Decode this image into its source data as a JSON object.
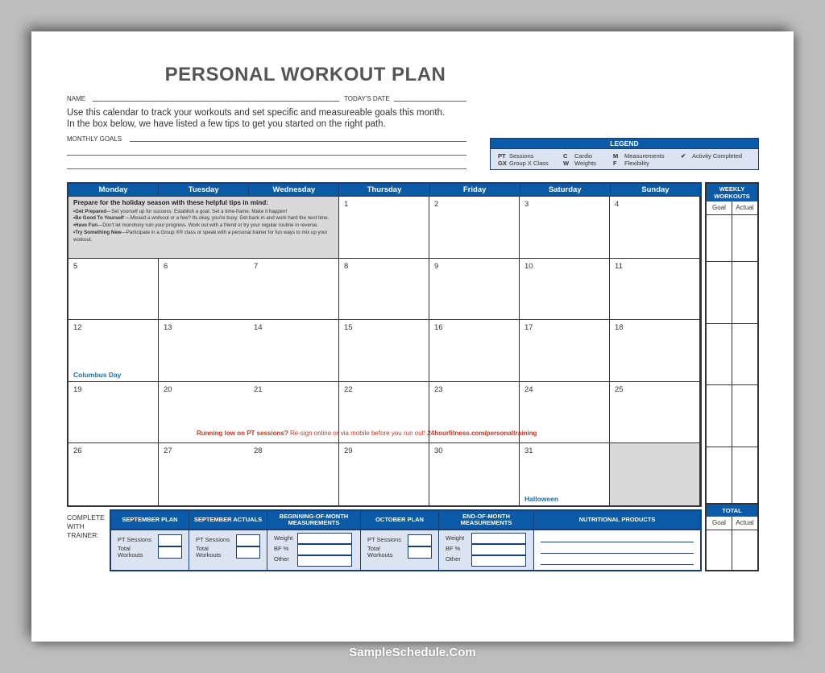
{
  "title": "PERSONAL WORKOUT PLAN",
  "form": {
    "name_label": "NAME",
    "date_label": "TODAY'S DATE",
    "intro_line1": "Use this calendar to track your workouts and set specific and measureable goals this month.",
    "intro_line2": "In the box below, we have listed a few tips to get you started on the right path.",
    "goals_label": "MONTHLY GOALS"
  },
  "legend": {
    "title": "LEGEND",
    "items": [
      {
        "code": "PT",
        "label": "Sessions"
      },
      {
        "code": "GX",
        "label": "Group X Class"
      },
      {
        "code": "C",
        "label": "Cardio"
      },
      {
        "code": "W",
        "label": "Weights"
      },
      {
        "code": "M",
        "label": "Measurements"
      },
      {
        "code": "F",
        "label": "Flexibility"
      },
      {
        "code": "✔",
        "label": "Activity Completed"
      }
    ]
  },
  "calendar": {
    "days": [
      "Monday",
      "Tuesday",
      "Wednesday",
      "Thursday",
      "Friday",
      "Saturday",
      "Sunday"
    ],
    "tips": {
      "heading": "Prepare for the holiday season with these helpful tips in mind:",
      "items": [
        {
          "title": "Get Prepared",
          "text": "—Set yourself up for success: Establish a goal. Set a time-frame. Make it happen!"
        },
        {
          "title": "Be Good To Yourself",
          "text": " —Missed a workout or a few? Its okay, you're busy. Get back in and work hard the next time."
        },
        {
          "title": "Have Fun",
          "text": "—Don't let monotony ruin your progress. Work out with a friend or try your regular routine in reverse."
        },
        {
          "title": "Try Something New",
          "text": "—Participate in a Group X® class or speak with a personal trainer for fun ways to mix up your workout."
        }
      ]
    },
    "week1": [
      "1",
      "2",
      "3",
      "4"
    ],
    "week2": [
      "5",
      "6",
      "7",
      "8",
      "9",
      "10",
      "11"
    ],
    "week3": [
      "12",
      "13",
      "14",
      "15",
      "16",
      "17",
      "18"
    ],
    "week4": [
      "19",
      "20",
      "21",
      "22",
      "23",
      "24",
      "25"
    ],
    "week5": [
      "26",
      "27",
      "28",
      "29",
      "30",
      "31"
    ],
    "holidays": {
      "columbus": "Columbus Day",
      "halloween": "Halloween"
    },
    "promo_bold": "Running low on PT sessions?",
    "promo_text": " Re-sign online or via mobile before you run out! ",
    "promo_link": "24hourfitness.com/personaltraining"
  },
  "weekly": {
    "title": "WEEKLY WORKOUTS",
    "goal": "Goal",
    "actual": "Actual"
  },
  "total": {
    "title": "TOTAL",
    "goal": "Goal",
    "actual": "Actual"
  },
  "bottom": {
    "trainer_label": [
      "COMPLETE",
      "WITH",
      "TRAINER:"
    ],
    "sept_plan": "SEPTEMBER PLAN",
    "sept_actuals": "SEPTEMBER ACTUALS",
    "begin_meas": "BEGINNING-OF-MONTH MEASUREMENTS",
    "oct_plan": "OCTOBER PLAN",
    "end_meas": "END-OF-MONTH MEASUREMENTS",
    "nutrition": "NUTRITIONAL PRODUCTS",
    "pt_sessions": "PT Sessions",
    "total": "Total",
    "workouts": "Workouts",
    "weight": "Weight",
    "bf": "BF %",
    "other": "Other"
  },
  "watermark": "SampleSchedule.Com",
  "colors": {
    "header_blue": "#0b5aa8",
    "promo_red": "#c0392b",
    "holiday_blue": "#1f6fa8"
  }
}
